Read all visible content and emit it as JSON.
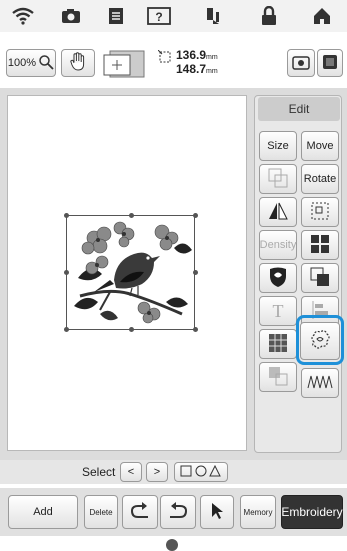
{
  "topbar": {
    "icons": [
      "wifi-icon",
      "camera-icon",
      "document-icon",
      "help-icon",
      "threading-icon",
      "lock-icon",
      "home-icon"
    ]
  },
  "toolbar": {
    "zoom_value": "100%",
    "width_value": "136.9",
    "height_value": "148.7",
    "unit": "mm"
  },
  "edit_panel": {
    "header": "Edit",
    "size_label": "Size",
    "move_label": "Move",
    "rotate_label": "Rotate",
    "density_label": "Density"
  },
  "select_row": {
    "label": "Select",
    "prev": "<",
    "next": ">"
  },
  "bottom_bar": {
    "add_label": "Add",
    "delete_label": "Delete",
    "memory_label": "Memory",
    "embroidery_label": "Embroidery"
  },
  "colors": {
    "highlight": "#1e90d8",
    "embroidery_button": "#333333"
  }
}
